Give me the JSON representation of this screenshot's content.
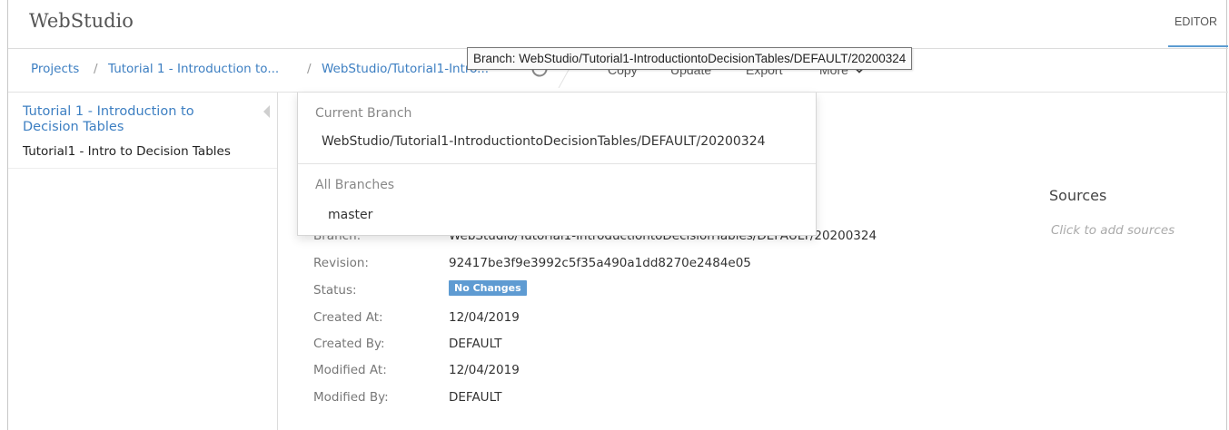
{
  "header": {
    "app_title": "WebStudio",
    "editor_tab": "EDITOR"
  },
  "breadcrumb": {
    "projects": "Projects",
    "separator": "/",
    "project": "Tutorial 1 - Introduction to...",
    "branch": "WebStudio/Tutorial1-Intro..."
  },
  "toolbar": {
    "copy": "Copy",
    "update": "Update",
    "export": "Export",
    "more": "More"
  },
  "tooltip": "Branch: WebStudio/Tutorial1-IntroductiontoDecisionTables/DEFAULT/20200324",
  "sidebar": {
    "project_title": "Tutorial 1 - Introduction to Decision Tables",
    "module": "Tutorial1 - Intro to Decision Tables"
  },
  "branch_dropdown": {
    "current_header": "Current Branch",
    "current_branch": "WebStudio/Tutorial1-IntroductiontoDecisionTables/DEFAULT/20200324",
    "all_header": "All Branches",
    "branches": [
      "master"
    ]
  },
  "details": {
    "branch_label": "Branch:",
    "branch_value": "WebStudio/Tutorial1-IntroductiontoDecisionTables/DEFAULT/20200324",
    "revision_label": "Revision:",
    "revision_value": "92417be3f9e3992c5f35a490a1dd8270e2484e05",
    "status_label": "Status:",
    "status_value": "No Changes",
    "created_at_label": "Created At:",
    "created_at_value": "12/04/2019",
    "created_by_label": "Created By:",
    "created_by_value": "DEFAULT",
    "modified_at_label": "Modified At:",
    "modified_at_value": "12/04/2019",
    "modified_by_label": "Modified By:",
    "modified_by_value": "DEFAULT"
  },
  "sources": {
    "title": "Sources",
    "add_hint": "Click to add sources"
  },
  "icons": {
    "refresh": "refresh-icon",
    "more": "chevron-down-icon",
    "collapse": "collapse-left-icon"
  },
  "colors": {
    "link": "#3d7fc2",
    "badge": "#5e9bd2",
    "accent": "#5b9bd1"
  }
}
